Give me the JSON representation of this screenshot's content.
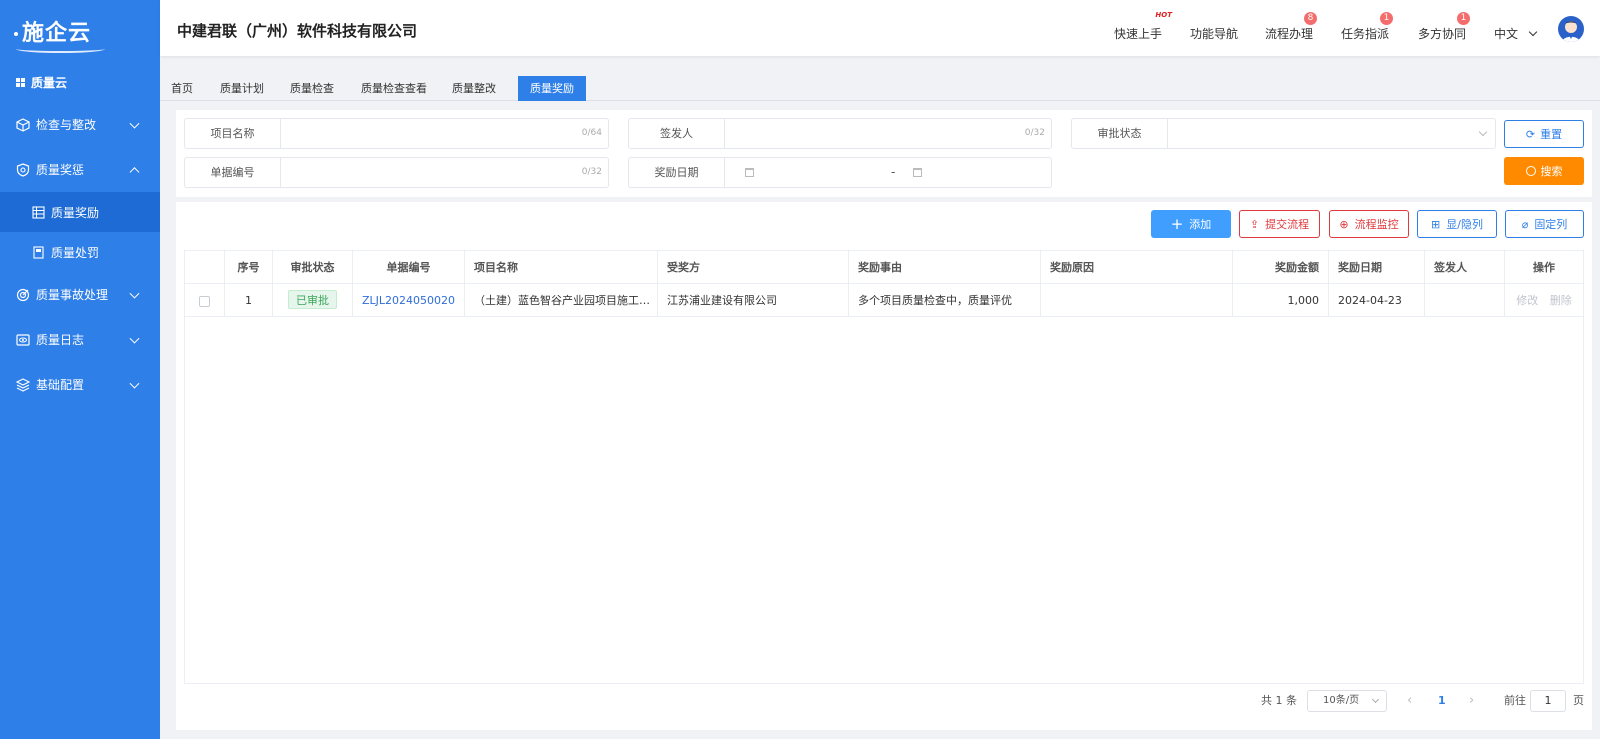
{
  "sidebar": {
    "logo": "施企云",
    "top_item": "质量云",
    "groups": [
      {
        "label": "检查与整改"
      },
      {
        "label": "质量奖惩"
      },
      {
        "label": "质量事故处理"
      },
      {
        "label": "质量日志"
      },
      {
        "label": "基础配置"
      }
    ],
    "sub_items": [
      {
        "label": "质量奖励"
      },
      {
        "label": "质量处罚"
      }
    ]
  },
  "header": {
    "company": "中建君联（广州）软件科技有限公司",
    "nav": [
      {
        "label": "快速上手",
        "hot": "HOT"
      },
      {
        "label": "功能导航"
      },
      {
        "label": "流程办理",
        "badge": "8"
      },
      {
        "label": "任务指派",
        "badge": "1"
      },
      {
        "label": "多方协同",
        "badge": "1"
      }
    ],
    "language": "中文"
  },
  "tabs": [
    "首页",
    "质量计划",
    "质量检查",
    "质量检查查看",
    "质量整改",
    "质量奖励"
  ],
  "search": {
    "project_name_label": "项目名称",
    "project_name_count": "0/64",
    "issuer_label": "签发人",
    "issuer_count": "0/32",
    "approval_label": "审批状态",
    "doc_no_label": "单据编号",
    "doc_no_count": "0/32",
    "reward_date_label": "奖励日期",
    "date_separator": "-",
    "reset_label": "重置",
    "search_label": "搜索"
  },
  "toolbar": {
    "add": "添加",
    "submit_flow": "提交流程",
    "monitor_flow": "流程监控",
    "show_hide": "显/隐列",
    "fix_cols": "固定列"
  },
  "table": {
    "headers": [
      "序号",
      "审批状态",
      "单据编号",
      "项目名称",
      "受奖方",
      "奖励事由",
      "奖励原因",
      "奖励金额",
      "奖励日期",
      "签发人",
      "操作"
    ],
    "rows": [
      {
        "index": "1",
        "status": "已审批",
        "doc_no": "ZLJL2024050020",
        "project": "（土建）蓝色智谷产业园项目施工总承包",
        "recipient": "江苏浦业建设有限公司",
        "reason": "多个项目质量检查中，质量评优",
        "cause": "",
        "amount": "1,000",
        "date": "2024-04-23",
        "issuer": "",
        "edit": "修改",
        "delete": "删除"
      }
    ]
  },
  "pagination": {
    "total": "共 1 条",
    "page_size": "10条/页",
    "current": "1",
    "goto_label": "前往",
    "goto_value": "1",
    "page_suffix": "页"
  },
  "colors": {
    "primary": "#2f7fe8",
    "orange": "#ff8a00",
    "danger": "#e0393e",
    "success": "#3aa65a"
  }
}
